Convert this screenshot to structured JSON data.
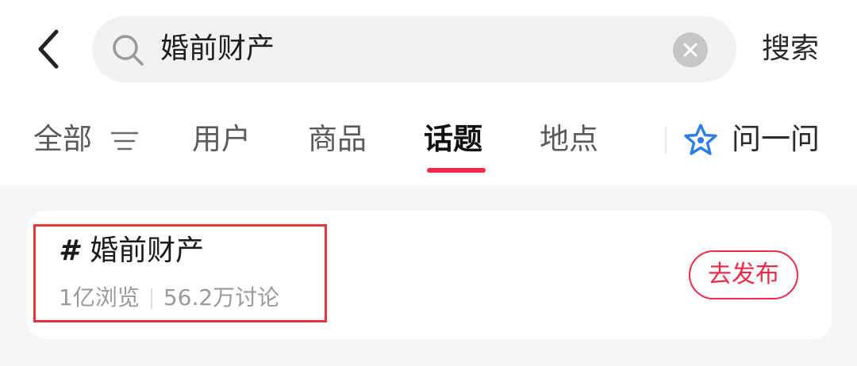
{
  "search": {
    "query": "婚前财产",
    "submit_label": "搜索"
  },
  "tabs": [
    {
      "label": "全部",
      "active": false
    },
    {
      "label": "用户",
      "active": false
    },
    {
      "label": "商品",
      "active": false
    },
    {
      "label": "话题",
      "active": true
    },
    {
      "label": "地点",
      "active": false
    }
  ],
  "ask": {
    "label": "问一问"
  },
  "topic": {
    "hash": "#",
    "title": "婚前财产",
    "views": "1亿浏览",
    "discussions": "56.2万讨论",
    "publish_label": "去发布"
  },
  "colors": {
    "accent": "#ee2b47",
    "highlight": "#e8353a",
    "ask_icon": "#2b7de9"
  }
}
